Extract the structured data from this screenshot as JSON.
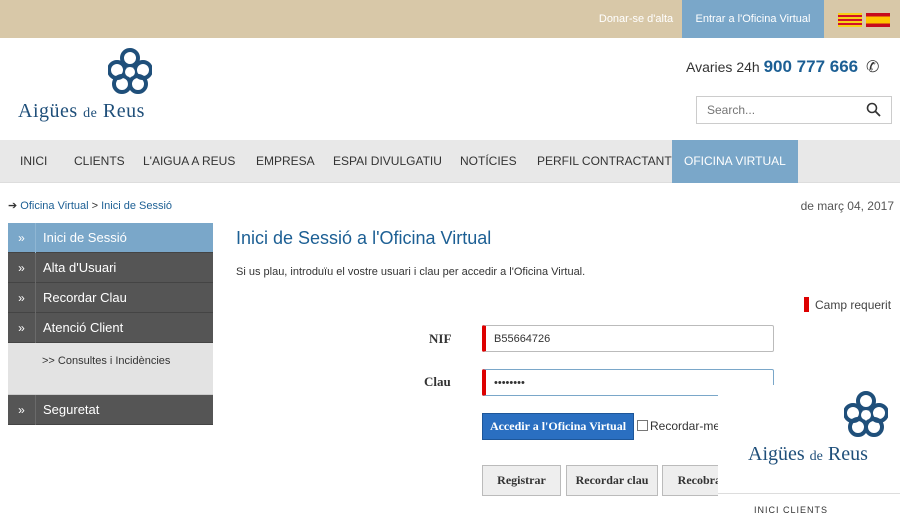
{
  "topbar": {
    "join_label": "Donar-se d'alta",
    "enter_label": "Entrar a l'Oficina Virtual"
  },
  "brand": {
    "name_main": "Aigües",
    "name_de": "de",
    "name_city": "Reus",
    "color": "#1f4f7a"
  },
  "contact": {
    "label": "Avaries 24h",
    "phone": "900 777 666"
  },
  "search": {
    "placeholder": "Search..."
  },
  "nav": {
    "items": [
      "INICI",
      "CLIENTS",
      "L'AIGUA A REUS",
      "EMPRESA",
      "ESPAI DIVULGATIU",
      "NOTÍCIES",
      "PERFIL CONTRACTANT",
      "OFICINA VIRTUAL"
    ],
    "active": "OFICINA VIRTUAL"
  },
  "breadcrumb": {
    "items": [
      "Oficina Virtual",
      "Inici de Sessió"
    ],
    "separator": ">"
  },
  "date": "de març 04, 2017",
  "sidebar": {
    "items": [
      {
        "label": "Inici de Sessió",
        "active": true
      },
      {
        "label": "Alta d'Usuari"
      },
      {
        "label": "Recordar Clau"
      },
      {
        "label": "Atenció Client"
      },
      {
        "label": "Seguretat"
      }
    ],
    "sub_item": ">> Consultes i Incidències"
  },
  "main": {
    "title": "Inici de Sessió a l'Oficina Virtual",
    "intro": "Si us plau, introduïu el vostre usuari i clau per accedir a l'Oficina Virtual.",
    "required_label": "Camp requerit",
    "nif_label": "NIF",
    "nif_value": "B55664726",
    "clau_label": "Clau",
    "clau_value": "••••••••",
    "submit_label": "Accedir a l'Oficina Virtual",
    "remember_label": "Recordar-me",
    "register_label": "Registrar",
    "recover_label": "Recordar clau",
    "recover2_label": "Recobrar"
  },
  "overlay": {
    "nav_text": "INICI     CLIENTS"
  },
  "colors": {
    "accent": "#7aa7c9",
    "link": "#1c5f94",
    "sidebar": "#555555",
    "required": "#dd0000",
    "primary_button": "#2a6fc1"
  }
}
